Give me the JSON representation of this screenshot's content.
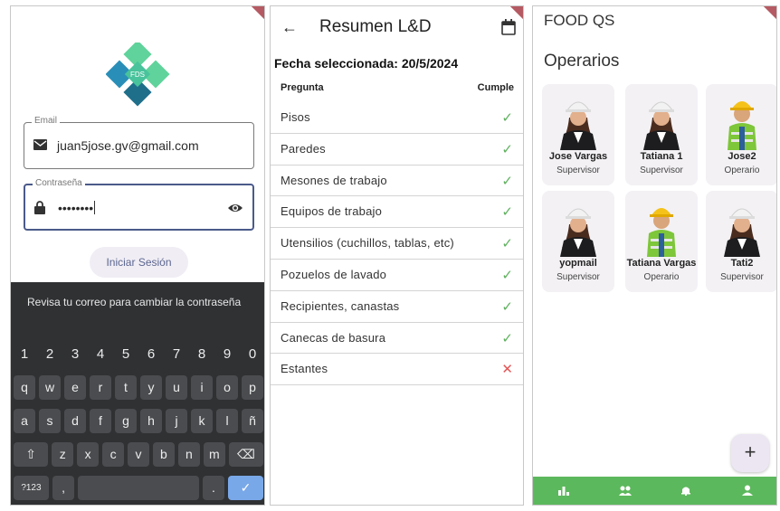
{
  "login": {
    "email_label": "Email",
    "email_value": "juan5jose.gv@gmail.com",
    "password_label": "Contraseña",
    "password_value": "••••••••",
    "login_button": "Iniciar Sesión",
    "keyboard_message": "Revisa tu correo para cambiar la contraseña",
    "logo_text": "FDS",
    "keyboard": {
      "numbers": [
        "1",
        "2",
        "3",
        "4",
        "5",
        "6",
        "7",
        "8",
        "9",
        "0"
      ],
      "row1": [
        "q",
        "w",
        "e",
        "r",
        "t",
        "y",
        "u",
        "i",
        "o",
        "p"
      ],
      "row2": [
        "a",
        "s",
        "d",
        "f",
        "g",
        "h",
        "j",
        "k",
        "l",
        "ñ"
      ],
      "row3": [
        "z",
        "x",
        "c",
        "v",
        "b",
        "n",
        "m"
      ],
      "symbols_key": "?123",
      "comma_key": ",",
      "period_key": "."
    }
  },
  "summary": {
    "title": "Resumen L&D",
    "selected_date": "Fecha seleccionada: 20/5/2024",
    "col_question": "Pregunta",
    "col_complies": "Cumple",
    "rows": [
      {
        "question": "Pisos",
        "complies": true
      },
      {
        "question": "Paredes",
        "complies": true
      },
      {
        "question": "Mesones de trabajo",
        "complies": true
      },
      {
        "question": "Equipos de trabajo",
        "complies": true
      },
      {
        "question": "Utensilios (cuchillos, tablas, etc)",
        "complies": true
      },
      {
        "question": "Pozuelos de lavado",
        "complies": true
      },
      {
        "question": "Recipientes, canastas",
        "complies": true
      },
      {
        "question": "Canecas de basura",
        "complies": true
      },
      {
        "question": "Estantes",
        "complies": false
      }
    ]
  },
  "operators": {
    "app_title": "FOOD QS",
    "section_title": "Operarios",
    "cards": [
      {
        "name": "Jose Vargas",
        "role": "Supervisor",
        "avatar": "woman-hardhat"
      },
      {
        "name": "Tatiana 1",
        "role": "Supervisor",
        "avatar": "woman-hardhat"
      },
      {
        "name": "Jose2",
        "role": "Operario",
        "avatar": "worker-vest"
      },
      {
        "name": "yopmail",
        "role": "Supervisor",
        "avatar": "woman-hardhat"
      },
      {
        "name": "Tatiana Vargas",
        "role": "Operario",
        "avatar": "worker-vest"
      },
      {
        "name": "Tati2",
        "role": "Supervisor",
        "avatar": "woman-hardhat"
      }
    ],
    "fab_label": "+",
    "nav": [
      "chart-icon",
      "group-icon",
      "bell-icon",
      "person-icon"
    ]
  },
  "colors": {
    "accent_green": "#5cb85c",
    "check_green": "#5fb05f",
    "error_red": "#e25656",
    "keyboard_bg": "#2f3133",
    "enter_key": "#79a8e8",
    "logo_green": "#4fc48a",
    "logo_blue": "#2a8fb8"
  }
}
